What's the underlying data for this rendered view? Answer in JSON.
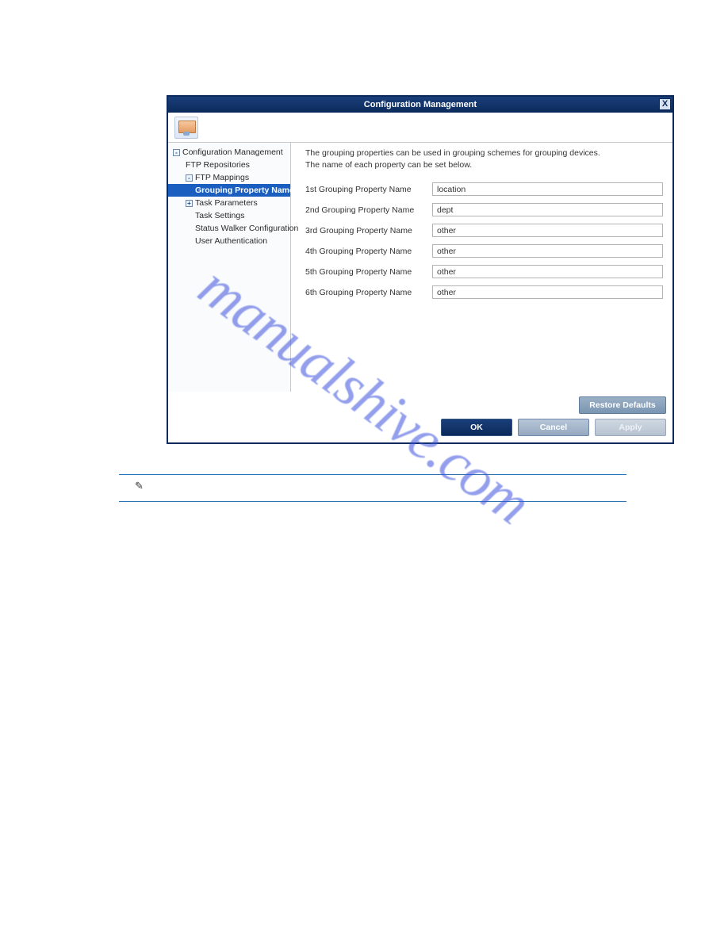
{
  "dialog": {
    "title": "Configuration Management",
    "close_glyph": "X"
  },
  "nav": {
    "items": [
      {
        "level": 1,
        "toggle": "-",
        "label": "Configuration Management",
        "selected": false
      },
      {
        "level": 2,
        "toggle": "",
        "label": "FTP Repositories",
        "selected": false
      },
      {
        "level": 2,
        "toggle": "-",
        "label": "FTP Mappings",
        "selected": false
      },
      {
        "level": 3,
        "toggle": "",
        "label": "Grouping Property Name",
        "selected": true
      },
      {
        "level": 2,
        "toggle": "+",
        "label": "Task Parameters",
        "selected": false
      },
      {
        "level": 3,
        "toggle": "",
        "label": "Task Settings",
        "selected": false
      },
      {
        "level": 3,
        "toggle": "",
        "label": "Status Walker Configuration",
        "selected": false
      },
      {
        "level": 3,
        "toggle": "",
        "label": "User Authentication",
        "selected": false
      }
    ]
  },
  "content": {
    "intro_line1": "The grouping properties can be used in grouping schemes for grouping devices.",
    "intro_line2": "The name of each property can be set below.",
    "props": [
      {
        "label": "1st Grouping Property Name",
        "value": "location"
      },
      {
        "label": "2nd Grouping Property Name",
        "value": "dept"
      },
      {
        "label": "3rd Grouping Property Name",
        "value": "other"
      },
      {
        "label": "4th Grouping Property Name",
        "value": "other"
      },
      {
        "label": "5th Grouping Property Name",
        "value": "other"
      },
      {
        "label": "6th Grouping Property Name",
        "value": "other"
      }
    ]
  },
  "buttons": {
    "restore": "Restore Defaults",
    "ok": "OK",
    "cancel": "Cancel",
    "apply": "Apply"
  },
  "watermark": "manualshive.com",
  "note_icon_glyph": "✎"
}
